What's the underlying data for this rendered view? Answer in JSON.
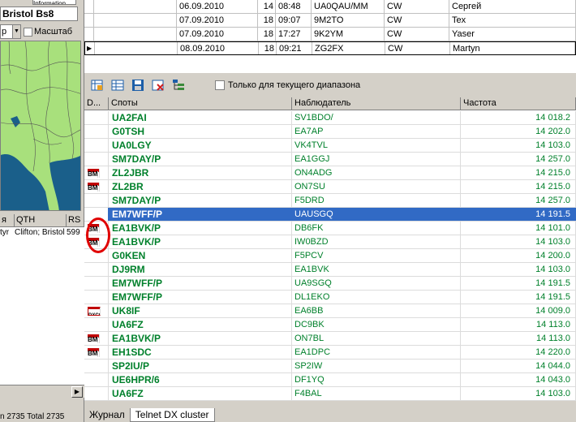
{
  "left": {
    "location_tab": "Information",
    "location": "Bristol Bs8",
    "map_select": "p",
    "map_label": "Масштаб",
    "qth_columns": [
      "я",
      "QTH",
      "RS"
    ],
    "qth_row": {
      "name": "tyr",
      "qth": "Clifton; Bristol",
      "rs": "599"
    },
    "status": "n 2735 Total 2735"
  },
  "log": {
    "rows": [
      {
        "date": "06.09.2010",
        "hour": "14",
        "time": "08:48",
        "call": "UA0QAU/MM",
        "mode": "CW",
        "name": "Сергей",
        "selected": false
      },
      {
        "date": "07.09.2010",
        "hour": "18",
        "time": "09:07",
        "call": "9M2TO",
        "mode": "CW",
        "name": "Tex",
        "selected": false
      },
      {
        "date": "07.09.2010",
        "hour": "18",
        "time": "17:27",
        "call": "9K2YM",
        "mode": "CW",
        "name": "Yaser",
        "selected": false
      },
      {
        "date": "08.09.2010",
        "hour": "18",
        "time": "09:21",
        "call": "ZG2FX",
        "mode": "CW",
        "name": "Martyn",
        "selected": true
      }
    ]
  },
  "toolbar": {
    "buttons": [
      "grid-add-icon",
      "grid-table-icon",
      "save-icon",
      "delete-icon",
      "tree-icon"
    ],
    "filter_label": "Только для текущего диапазона"
  },
  "spots": {
    "columns": {
      "d": "D...",
      "spot": "Споты",
      "observer": "Наблюдатель",
      "freq": "Частота"
    },
    "rows": [
      {
        "icon": "",
        "spot": "UA2FAI",
        "observer": "SV1BDO/",
        "freq": "14 018.2"
      },
      {
        "icon": "",
        "spot": "G0TSH",
        "observer": "EA7AP",
        "freq": "14 202.0"
      },
      {
        "icon": "",
        "spot": "UA0LGY",
        "observer": "VK4TVL",
        "freq": "14 103.0"
      },
      {
        "icon": "",
        "spot": "SM7DAY/P",
        "observer": "EA1GGJ",
        "freq": "14 257.0"
      },
      {
        "icon": "bm",
        "spot": "ZL2JBR",
        "observer": "ON4ADG",
        "freq": "14 215.0"
      },
      {
        "icon": "bm",
        "spot": "ZL2BR",
        "observer": "ON7SU",
        "freq": "14 215.0"
      },
      {
        "icon": "",
        "spot": "SM7DAY/P",
        "observer": "F5DRD",
        "freq": "14 257.0"
      },
      {
        "icon": "",
        "spot": "EM7WFF/P",
        "observer": "UAUSGQ",
        "freq": "14 191.5",
        "highlight": true
      },
      {
        "icon": "bm",
        "spot": "EA1BVK/P",
        "observer": "DB6FK",
        "freq": "14 101.0"
      },
      {
        "icon": "bm",
        "spot": "EA1BVK/P",
        "observer": "IW0BZD",
        "freq": "14 103.0"
      },
      {
        "icon": "",
        "spot": "G0KEN",
        "observer": "F5PCV",
        "freq": "14 200.0"
      },
      {
        "icon": "",
        "spot": "DJ9RM",
        "observer": "EA1BVK",
        "freq": "14 103.0"
      },
      {
        "icon": "",
        "spot": "EM7WFF/P",
        "observer": "UA9SGQ",
        "freq": "14 191.5"
      },
      {
        "icon": "",
        "spot": "EM7WFF/P",
        "observer": "DL1EKO",
        "freq": "14 191.5"
      },
      {
        "icon": "dxcc",
        "spot": "UK8IF",
        "observer": "EA6BB",
        "freq": "14 009.0"
      },
      {
        "icon": "",
        "spot": "UA6FZ",
        "observer": "DC9BK",
        "freq": "14 113.0"
      },
      {
        "icon": "bm",
        "spot": "EA1BVK/P",
        "observer": "ON7BL",
        "freq": "14 113.0"
      },
      {
        "icon": "bm",
        "spot": "EH1SDC",
        "observer": "EA1DPC",
        "freq": "14 220.0"
      },
      {
        "icon": "",
        "spot": "SP2IU/P",
        "observer": "SP2IW",
        "freq": "14 044.0"
      },
      {
        "icon": "",
        "spot": "UE6HPR/6",
        "observer": "DF1YQ",
        "freq": "14 043.0"
      },
      {
        "icon": "",
        "spot": "UA6FZ",
        "observer": "F4BAL",
        "freq": "14 103.0"
      }
    ],
    "bm_label": "BM",
    "dxcc_label": "DXCC"
  },
  "tabs": [
    "Журнал",
    "Telnet DX cluster"
  ],
  "colors": {
    "spot_green": "#00802b",
    "highlight": "#316ac5",
    "annotation_red": "#e00000"
  }
}
